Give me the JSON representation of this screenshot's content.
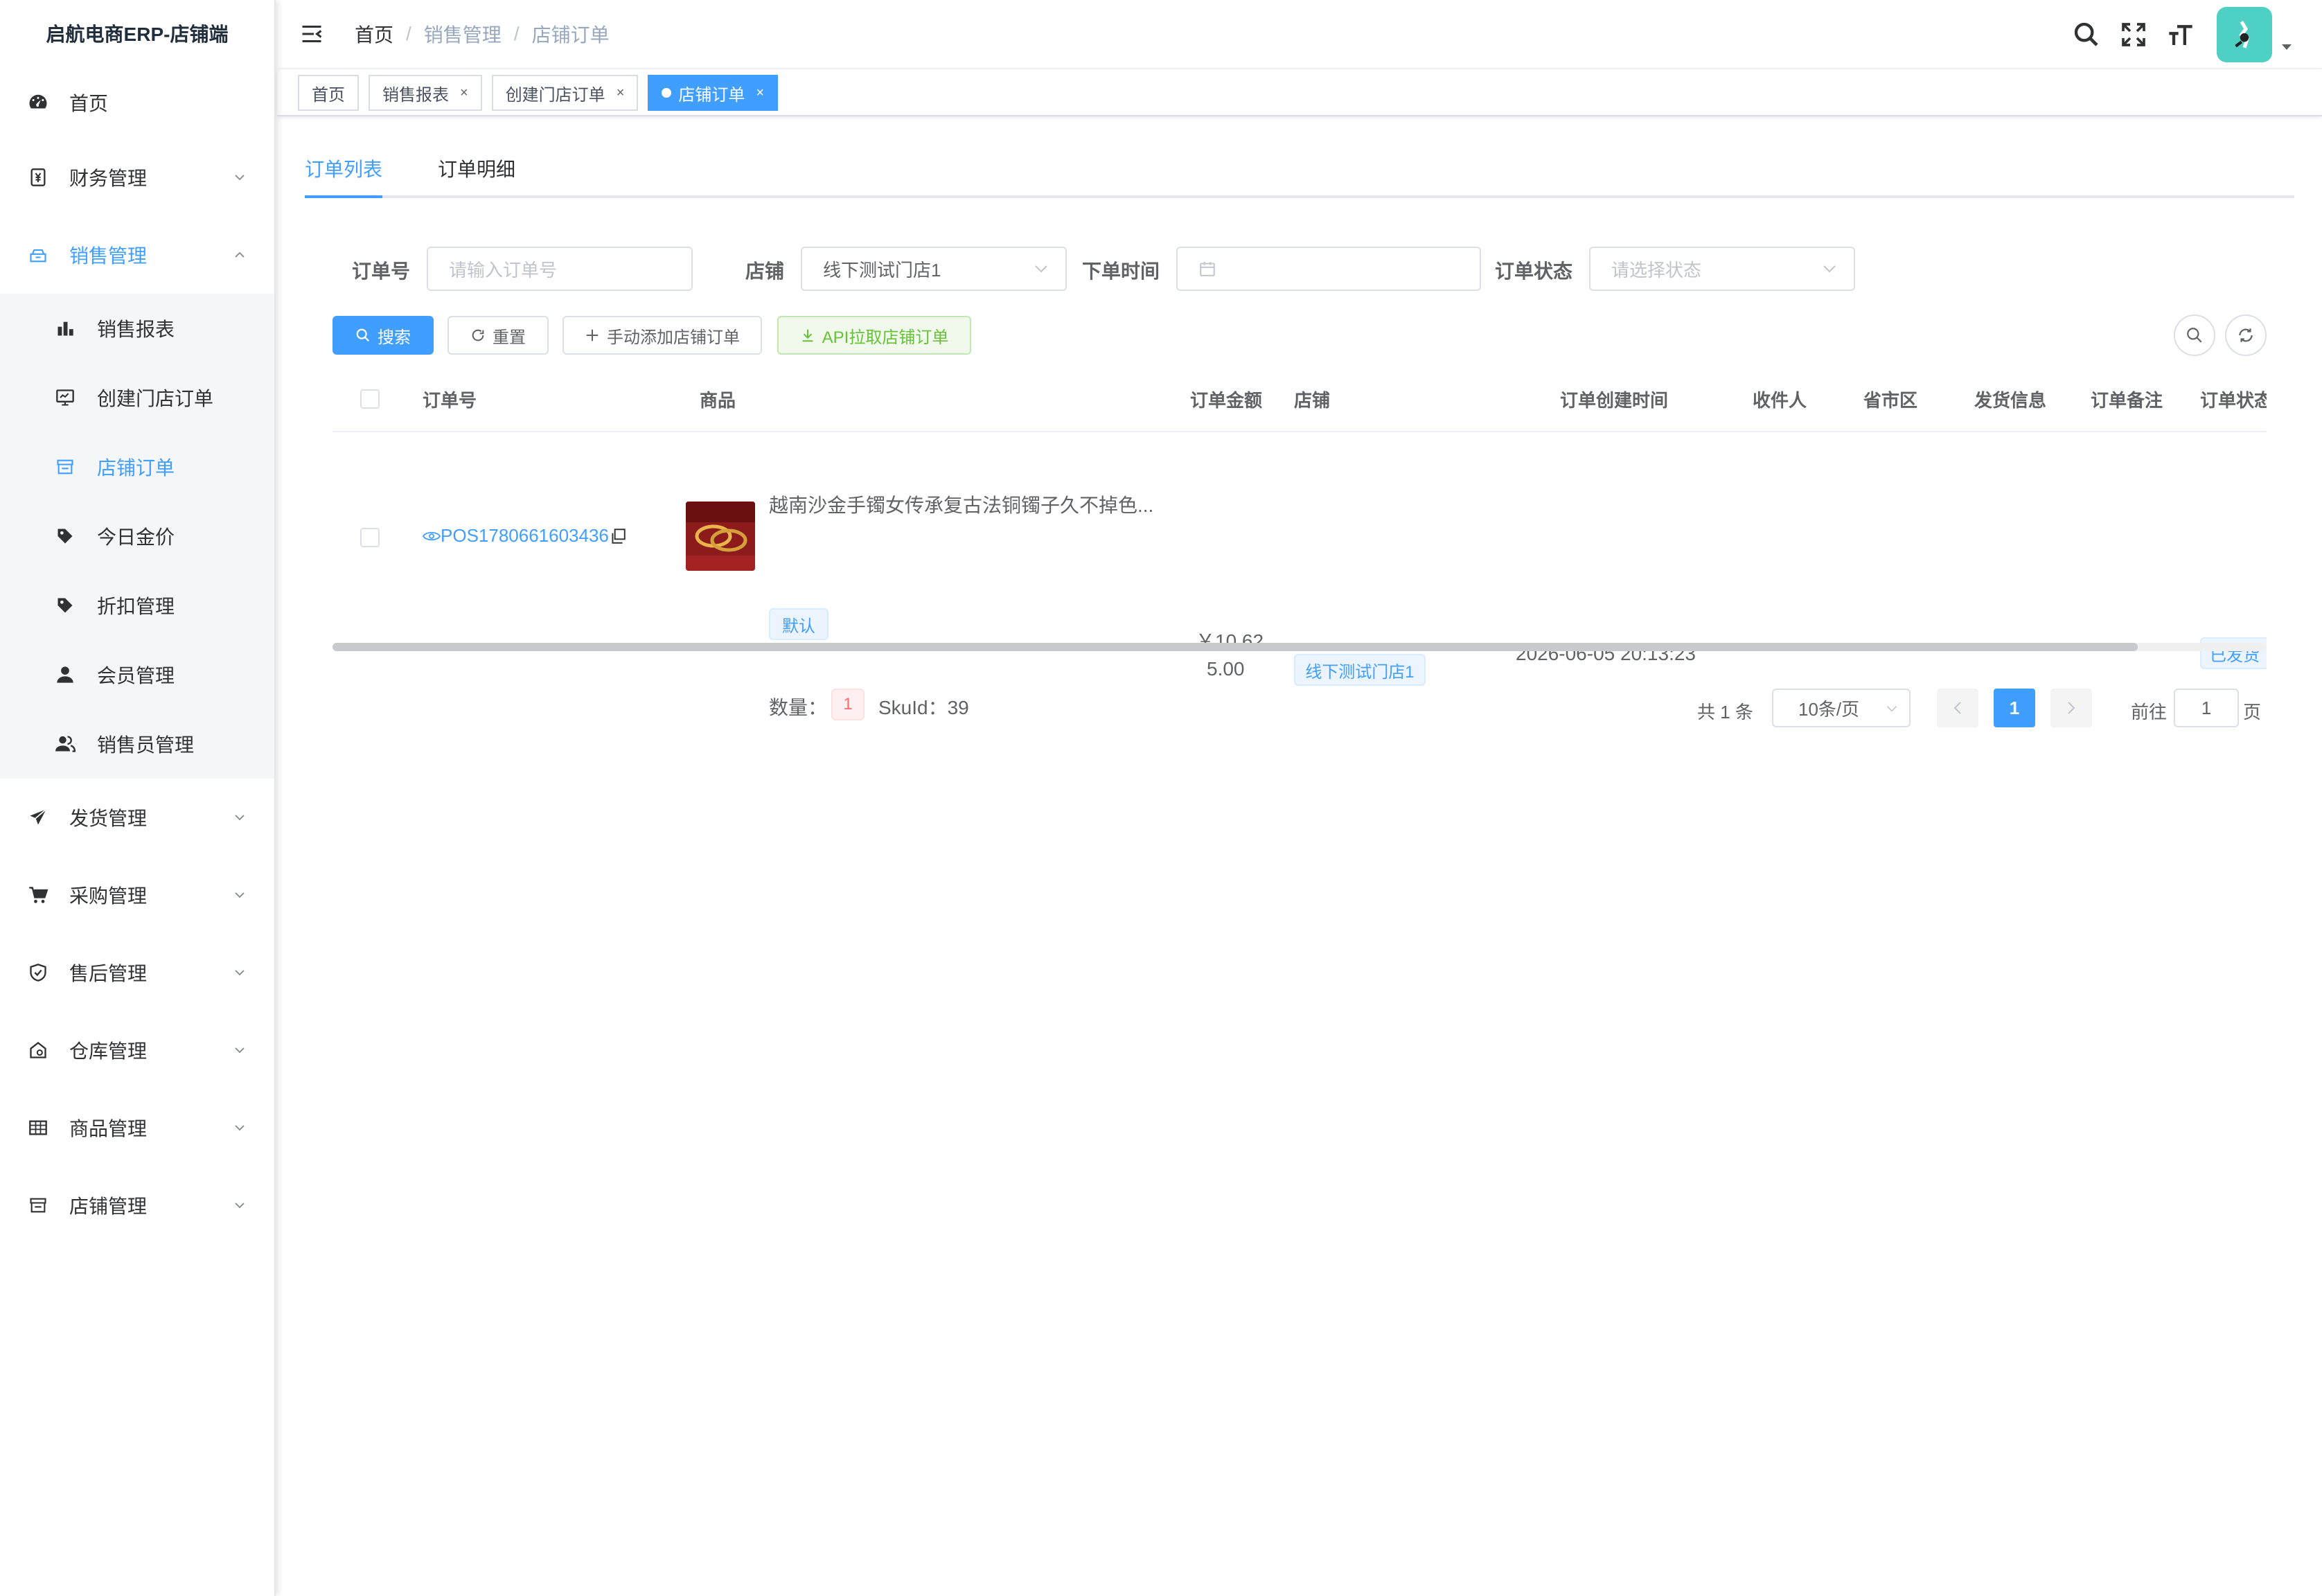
{
  "app": {
    "title": "启航电商ERP-店铺端"
  },
  "sidebar": {
    "items": [
      {
        "label": "首页",
        "icon": "dashboard-icon"
      },
      {
        "label": "财务管理",
        "icon": "finance-icon"
      },
      {
        "label": "销售管理",
        "icon": "sales-icon"
      },
      {
        "label": "发货管理",
        "icon": "send-icon"
      },
      {
        "label": "采购管理",
        "icon": "cart-icon"
      },
      {
        "label": "售后管理",
        "icon": "shield-icon"
      },
      {
        "label": "仓库管理",
        "icon": "warehouse-icon"
      },
      {
        "label": "商品管理",
        "icon": "table-icon"
      },
      {
        "label": "店铺管理",
        "icon": "store-icon"
      }
    ],
    "sales_submenu": [
      {
        "label": "销售报表",
        "icon": "bar-chart-icon"
      },
      {
        "label": "创建门店订单",
        "icon": "monitor-icon"
      },
      {
        "label": "店铺订单",
        "icon": "store-icon",
        "active": true
      },
      {
        "label": "今日金价",
        "icon": "price-tag-icon"
      },
      {
        "label": "折扣管理",
        "icon": "discount-tag-icon"
      },
      {
        "label": "会员管理",
        "icon": "user-icon"
      },
      {
        "label": "销售员管理",
        "icon": "users-icon"
      }
    ]
  },
  "breadcrumb": [
    "首页",
    "销售管理",
    "店铺订单"
  ],
  "tags": [
    {
      "label": "首页"
    },
    {
      "label": "销售报表"
    },
    {
      "label": "创建门店订单"
    },
    {
      "label": "店铺订单",
      "active": true
    }
  ],
  "tabs": [
    "订单列表",
    "订单明细"
  ],
  "filters": {
    "order_no": {
      "label": "订单号",
      "placeholder": "请输入订单号"
    },
    "shop": {
      "label": "店铺",
      "value": "线下测试门店1"
    },
    "order_time": {
      "label": "下单时间"
    },
    "status": {
      "label": "订单状态",
      "placeholder": "请选择状态"
    }
  },
  "buttons": {
    "search": "搜索",
    "reset": "重置",
    "add": "手动添加店铺订单",
    "api_pull": "API拉取店铺订单"
  },
  "table": {
    "columns": [
      "订单号",
      "商品",
      "订单金额",
      "店铺",
      "订单创建时间",
      "收件人",
      "省市区",
      "发货信息",
      "订单备注",
      "订单状态"
    ],
    "rows": [
      {
        "order_no": "POS1780661603436",
        "product_name": "越南沙金手镯女传承复古法铜镯子久不掉色...",
        "sku_tag": "默认",
        "qty_label": "数量：",
        "qty": "1",
        "sku_id_text": "SkuId：39",
        "amount_line1": "￥10,62",
        "amount_line2": "5.00",
        "shop": "线下测试门店1",
        "created_at": "2026-06-05 20:13:23",
        "status": "已发货"
      }
    ]
  },
  "pagination": {
    "total": "共 1 条",
    "page_size": "10条/页",
    "current": "1",
    "goto_label": "前往",
    "goto_value": "1",
    "page_suffix": "页"
  },
  "colors": {
    "primary": "#409eff",
    "success": "#67c23a",
    "danger": "#f56c6c",
    "text": "#303133"
  }
}
